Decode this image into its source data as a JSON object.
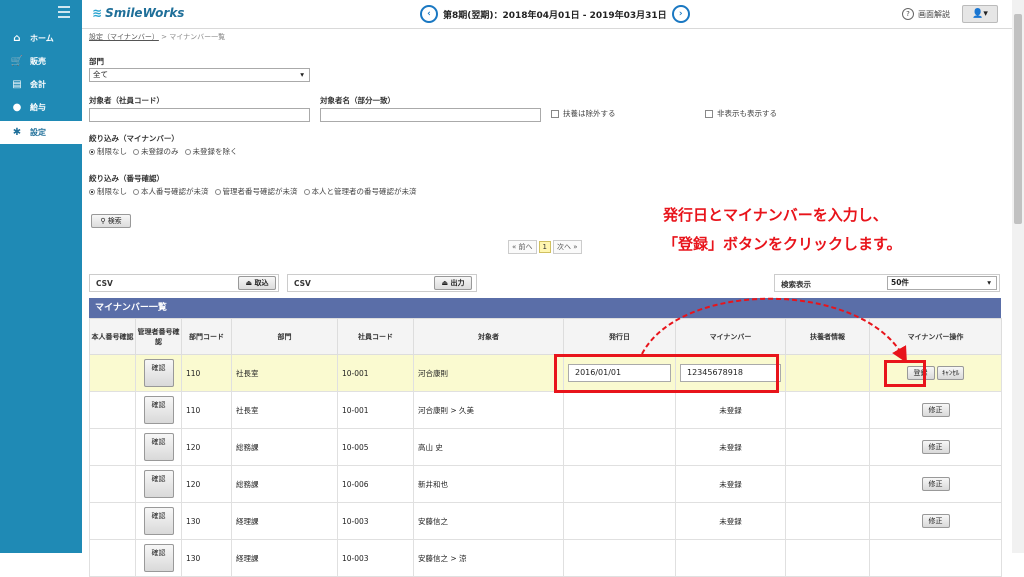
{
  "app": {
    "logo": "SmileWorks",
    "period": "第8期(翌期)：2018年04月01日 - 2019年03月31日",
    "help_label": "画面解説"
  },
  "sidebar": {
    "items": [
      {
        "label": "ホーム",
        "icon": "home-icon"
      },
      {
        "label": "販売",
        "icon": "cart-icon"
      },
      {
        "label": "会計",
        "icon": "ledger-icon"
      },
      {
        "label": "給与",
        "icon": "money-bag-icon"
      },
      {
        "label": "設定",
        "icon": "gear-icon"
      }
    ]
  },
  "breadcrumb": {
    "parent": "設定（マイナンバー）",
    "sep": ">",
    "current": "マイナンバー一覧"
  },
  "filters": {
    "dept_label": "部門",
    "dept_value": "全て",
    "target_code_label": "対象者（社員コード）",
    "target_name_label": "対象者名（部分一致）",
    "exclude_dependents": "扶養は除外する",
    "show_hidden": "非表示も表示する",
    "narrow_mynumber_label": "絞り込み（マイナンバー）",
    "narrow_mynumber_options": [
      "制限なし",
      "未登録のみ",
      "未登録を除く"
    ],
    "narrow_verify_label": "絞り込み（番号確認）",
    "narrow_verify_options": [
      "制限なし",
      "本人番号確認が未済",
      "管理者番号確認が未済",
      "本人と管理者の番号確認が未済"
    ],
    "search_button": "検索"
  },
  "annotation": {
    "line1": "発行日とマイナンバーを入力し、",
    "line2": "「登録」ボタンをクリックします。"
  },
  "pager": {
    "prev": "« 前へ",
    "page": "1",
    "next": "次へ »"
  },
  "csv": {
    "import_label": "CSV",
    "import_button": "取込",
    "export_label": "CSV",
    "export_button": "出力",
    "display_count_label": "検索表示",
    "display_count_value": "50件"
  },
  "list": {
    "title": "マイナンバー一覧",
    "columns": [
      "本人番号確認",
      "管理者番号確認",
      "部門コード",
      "部門",
      "社員コード",
      "対象者",
      "発行日",
      "マイナンバー",
      "扶養者情報",
      "マイナンバー操作"
    ],
    "verify_button": "確認",
    "unregistered": "未登録",
    "register_button": "登録",
    "cancel_button": "ｷｬﾝｾﾙ",
    "edit_button": "修正",
    "rows": [
      {
        "dept_code": "110",
        "dept": "社長室",
        "emp_code": "10-001",
        "name": "河合康則",
        "issue_date": "2016/01/01",
        "mynumber": "12345678918",
        "editing": true
      },
      {
        "dept_code": "110",
        "dept": "社長室",
        "emp_code": "10-001",
        "name": "河合康則 > 久美",
        "editing": false
      },
      {
        "dept_code": "120",
        "dept": "総務課",
        "emp_code": "10-005",
        "name": "高山 史",
        "editing": false
      },
      {
        "dept_code": "120",
        "dept": "総務課",
        "emp_code": "10-006",
        "name": "新井和也",
        "editing": false
      },
      {
        "dept_code": "130",
        "dept": "経理課",
        "emp_code": "10-003",
        "name": "安藤信之",
        "editing": false
      },
      {
        "dept_code": "130",
        "dept": "経理課",
        "emp_code": "10-003",
        "name": "安藤信之 > 涼",
        "editing": false
      }
    ]
  },
  "colors": {
    "sidebar": "#1f8ab5",
    "list_header": "#5a6ea8",
    "annotation": "#e8141b",
    "editing_row": "#fafad0"
  }
}
